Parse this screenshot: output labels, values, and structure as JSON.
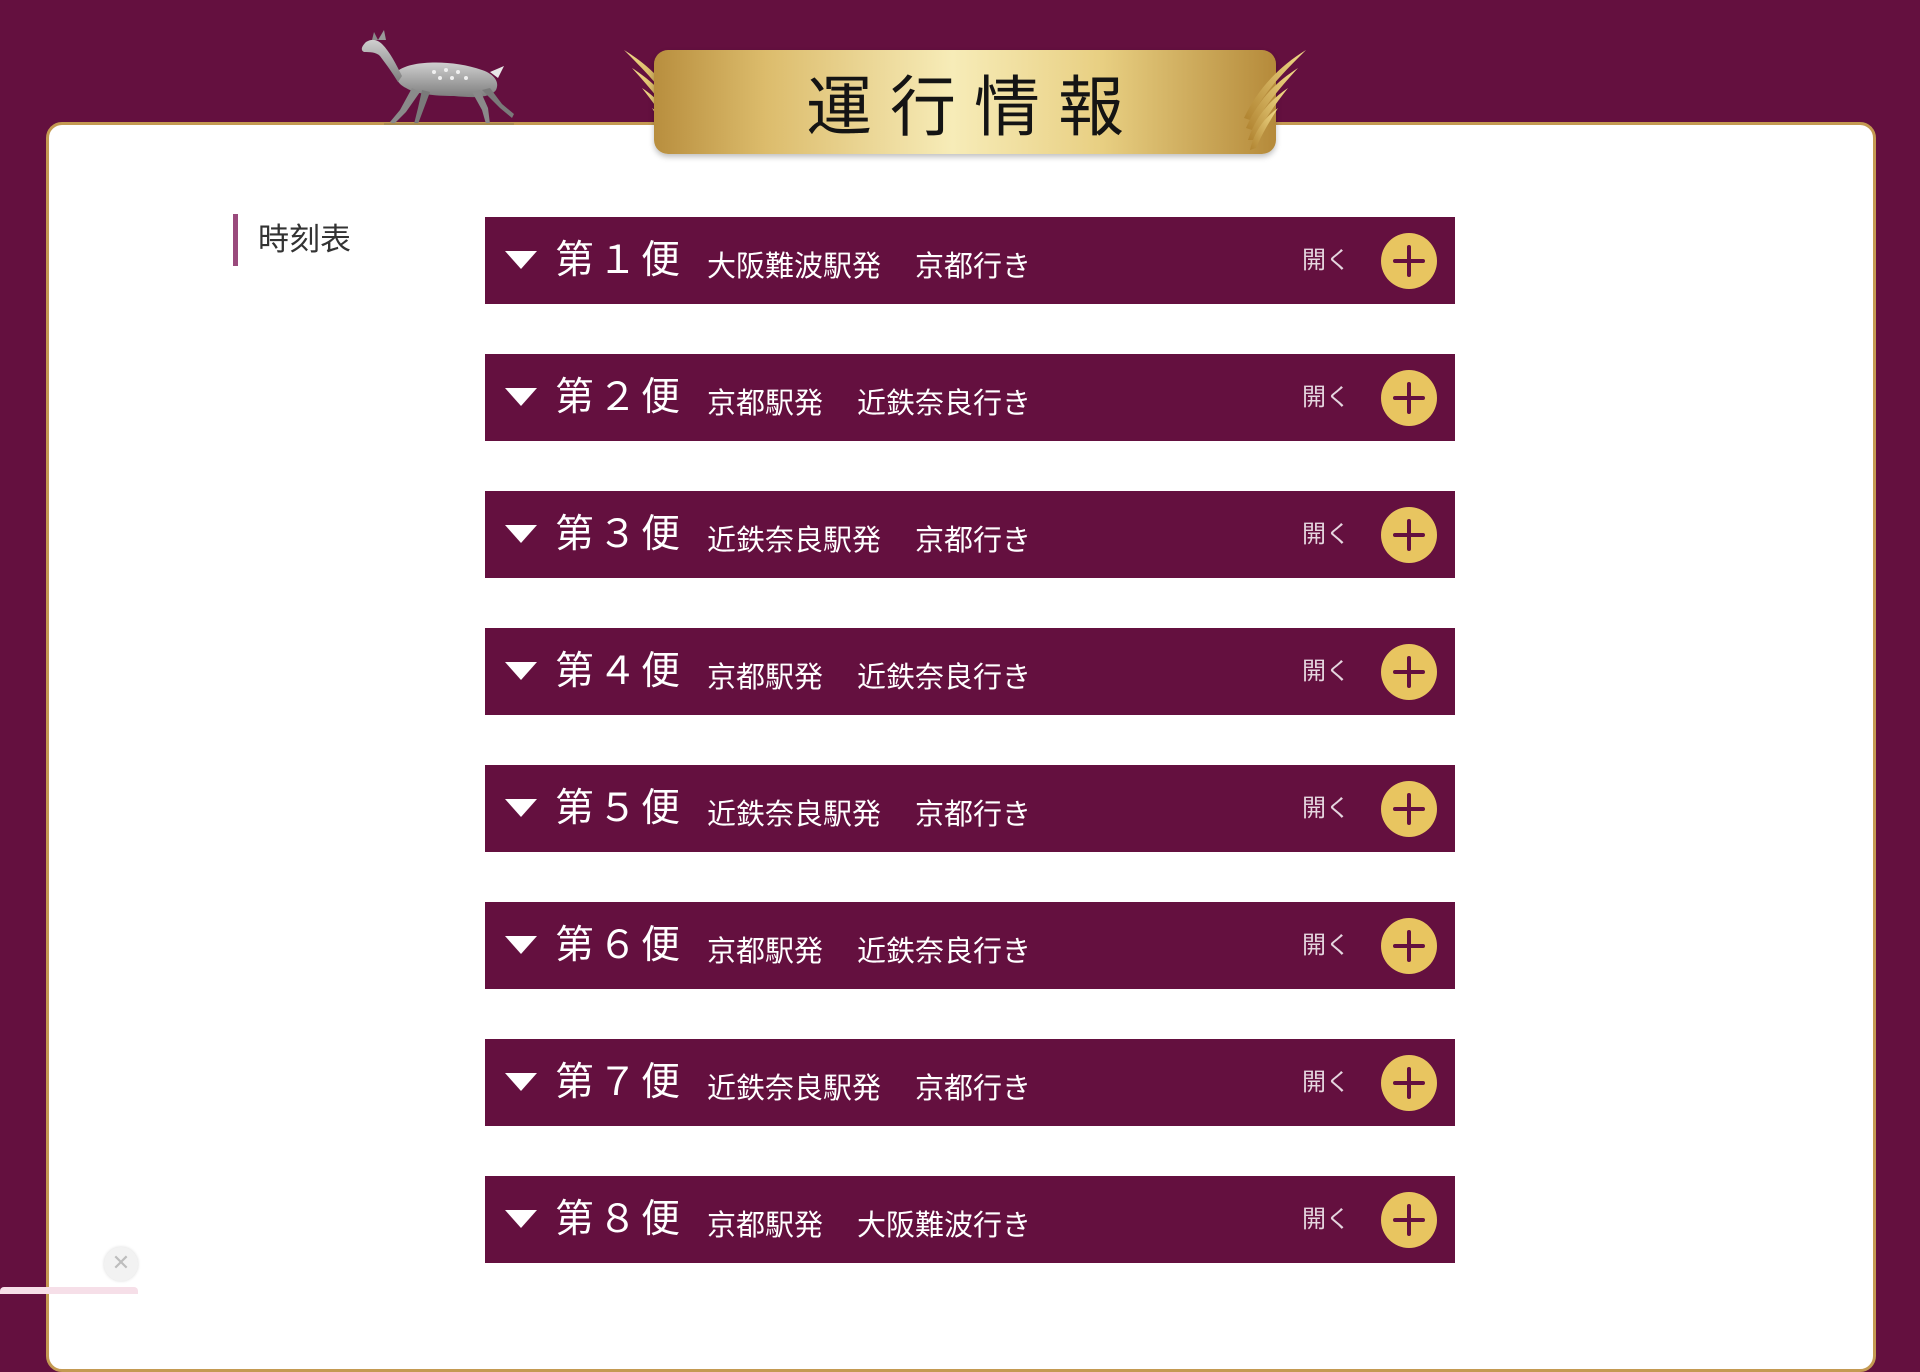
{
  "header": {
    "title": "運行情報"
  },
  "sidebar": {
    "items": [
      {
        "label": "時刻表"
      }
    ]
  },
  "trips": [
    {
      "number": "第１便",
      "from": "大阪難波駅発",
      "to": "京都行き",
      "toggle_label": "開く"
    },
    {
      "number": "第２便",
      "from": "京都駅発",
      "to": "近鉄奈良行き",
      "toggle_label": "開く"
    },
    {
      "number": "第３便",
      "from": "近鉄奈良駅発",
      "to": "京都行き",
      "toggle_label": "開く"
    },
    {
      "number": "第４便",
      "from": "京都駅発",
      "to": "近鉄奈良行き",
      "toggle_label": "開く"
    },
    {
      "number": "第５便",
      "from": "近鉄奈良駅発",
      "to": "京都行き",
      "toggle_label": "開く"
    },
    {
      "number": "第６便",
      "from": "京都駅発",
      "to": "近鉄奈良行き",
      "toggle_label": "開く"
    },
    {
      "number": "第７便",
      "from": "近鉄奈良駅発",
      "to": "京都行き",
      "toggle_label": "開く"
    },
    {
      "number": "第８便",
      "from": "京都駅発",
      "to": "大阪難波行き",
      "toggle_label": "開く"
    }
  ],
  "icons": {
    "expand": "plus-icon",
    "collapse_indicator": "triangle-down-icon",
    "close": "close-icon",
    "mascot": "deer-icon"
  },
  "colors": {
    "brand": "#64103f",
    "gold": "#e8c560",
    "accent_bar": "#9a4a7c",
    "border": "#c49a52"
  }
}
